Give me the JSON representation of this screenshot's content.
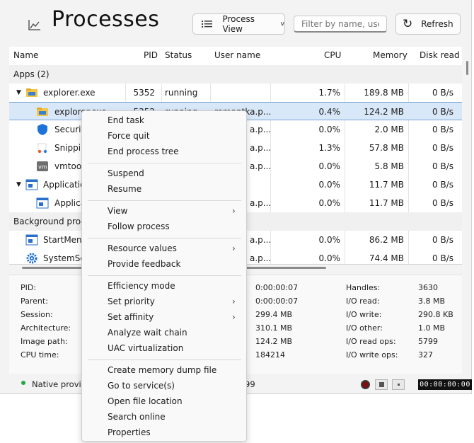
{
  "header": {
    "title": "Processes",
    "view_button": "Process View",
    "filter_placeholder": "Filter by name, use...",
    "refresh_button": "Refresh"
  },
  "columns": [
    "Name",
    "PID",
    "Status",
    "User name",
    "CPU",
    "Memory",
    "Disk read"
  ],
  "groups": {
    "apps": "Apps (2)",
    "background": "Background proce"
  },
  "rows": [
    {
      "name": "explorer.exe",
      "pid": "5352",
      "status": "running",
      "user": "",
      "cpu": "1.7%",
      "memory": "189.8 MB",
      "disk": "0 B/s"
    },
    {
      "name": "explorer.exe",
      "pid": "5352",
      "status": "running",
      "user": "romantka.p...",
      "cpu": "0.4%",
      "memory": "124.2 MB",
      "disk": "0 B/s"
    },
    {
      "name": "Security",
      "pid": "",
      "status": "",
      "user": "a.p...",
      "cpu": "0.0%",
      "memory": "2.0 MB",
      "disk": "0 B/s"
    },
    {
      "name": "Snippin",
      "pid": "",
      "status": "",
      "user": "a.p...",
      "cpu": "1.3%",
      "memory": "57.8 MB",
      "disk": "0 B/s"
    },
    {
      "name": "vmtool",
      "pid": "",
      "status": "",
      "user": "a.p...",
      "cpu": "0.0%",
      "memory": "5.8 MB",
      "disk": "0 B/s"
    },
    {
      "name": "Applicatio",
      "pid": "",
      "status": "",
      "user": "",
      "cpu": "0.0%",
      "memory": "11.7 MB",
      "disk": "0 B/s"
    },
    {
      "name": "Applica",
      "pid": "",
      "status": "",
      "user": "a.p...",
      "cpu": "0.0%",
      "memory": "11.7 MB",
      "disk": "0 B/s"
    },
    {
      "name": "StartMenu",
      "pid": "",
      "status": "",
      "user": "a.p...",
      "cpu": "0.0%",
      "memory": "86.2 MB",
      "disk": "0 B/s"
    },
    {
      "name": "SystemSet",
      "pid": "",
      "status": "",
      "user": "a.p...",
      "cpu": "0.0%",
      "memory": "74.4 MB",
      "disk": "0 B/s"
    }
  ],
  "details": {
    "labels_left": [
      "PID:",
      "Parent:",
      "Session:",
      "Architecture:",
      "Image path:",
      "CPU time:"
    ],
    "values_mid": [
      "0:00:00:07",
      "0:00:00:07",
      "299.4 MB",
      "310.1 MB",
      "124.2 MB",
      "184214"
    ],
    "labels_right": [
      "Handles:",
      "I/O read:",
      "I/O write:",
      "I/O other:",
      "I/O read ops:",
      "I/O write ops:"
    ],
    "values_right": [
      "3630",
      "3.8 MB",
      "290.8 KB",
      "1.0 MB",
      "5799",
      "327"
    ]
  },
  "status": {
    "text": "Native provic",
    "tail": "99",
    "timer": "00:00:00:00"
  },
  "context_menu": [
    {
      "label": "End task",
      "submenu": false
    },
    {
      "label": "Force quit",
      "submenu": false
    },
    {
      "label": "End process tree",
      "submenu": false
    },
    {
      "label": "Suspend",
      "submenu": false
    },
    {
      "label": "Resume",
      "submenu": false
    },
    {
      "label": "View",
      "submenu": true
    },
    {
      "label": "Follow process",
      "submenu": false
    },
    {
      "label": "Resource values",
      "submenu": true
    },
    {
      "label": "Provide feedback",
      "submenu": false
    },
    {
      "label": "Efficiency mode",
      "submenu": false
    },
    {
      "label": "Set priority",
      "submenu": true
    },
    {
      "label": "Set affinity",
      "submenu": true
    },
    {
      "label": "Analyze wait chain",
      "submenu": false
    },
    {
      "label": "UAC virtualization",
      "submenu": false
    },
    {
      "label": "Create memory dump file",
      "submenu": false
    },
    {
      "label": "Go to service(s)",
      "submenu": false
    },
    {
      "label": "Open file location",
      "submenu": false
    },
    {
      "label": "Search online",
      "submenu": false
    },
    {
      "label": "Properties",
      "submenu": false
    }
  ],
  "colors": {
    "selection": "#d9e8f8",
    "selection_border": "#7aa6d6",
    "status_dot": "#28a745"
  }
}
